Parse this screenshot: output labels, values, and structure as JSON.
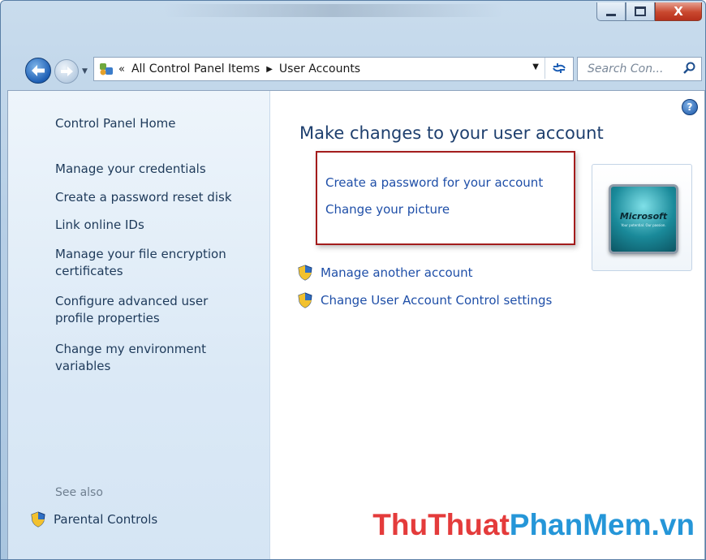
{
  "window": {
    "caption_buttons": {
      "minimize_icon": "minimize-icon",
      "maximize_icon": "maximize-icon",
      "close_label": "X"
    }
  },
  "navbar": {
    "address_prefix": "«",
    "breadcrumb": [
      "All Control Panel Items",
      "User Accounts"
    ],
    "search_placeholder": "Search Con..."
  },
  "sidebar": {
    "items": [
      "Control Panel Home",
      "Manage your credentials",
      "Create a password reset disk",
      "Link online IDs",
      "Manage your file encryption certificates",
      "Configure advanced user profile properties",
      "Change my environment variables"
    ],
    "see_also_label": "See also",
    "parental_controls": "Parental Controls"
  },
  "main": {
    "help_label": "?",
    "heading": "Make changes to your user account",
    "links": [
      "Create a password for your account",
      "Change your picture"
    ],
    "shield_links": [
      "Manage another account",
      "Change User Account Control settings"
    ],
    "picture_text": "Microsoft",
    "picture_tagline": "Your potential. Our passion."
  },
  "watermark": {
    "part1": "ThuThuat",
    "part2": "PhanMem.vn"
  },
  "colors": {
    "link": "#1f4fa8",
    "heading": "#1e3f6e",
    "highlight_box": "#a31c1c"
  }
}
